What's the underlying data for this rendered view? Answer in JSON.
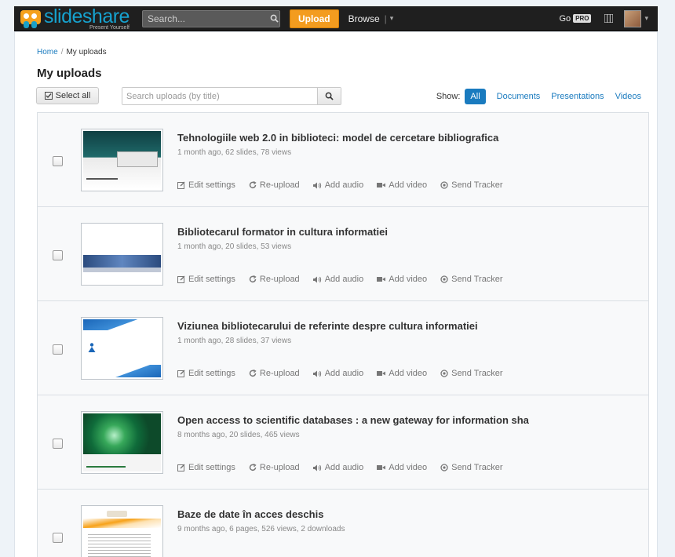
{
  "navbar": {
    "logo_main": "slideshare",
    "logo_tagline": "Present Yourself",
    "search_placeholder": "Search...",
    "upload_label": "Upload",
    "browse_label": "Browse",
    "go_label": "Go",
    "pro_badge": "PRO"
  },
  "breadcrumb": {
    "home": "Home",
    "separator": "/",
    "current": "My uploads"
  },
  "page_title": "My uploads",
  "toolbar": {
    "select_all_label": "Select all",
    "search_placeholder": "Search uploads (by title)",
    "show_label": "Show:",
    "filters": [
      {
        "label": "All",
        "active": true
      },
      {
        "label": "Documents",
        "active": false
      },
      {
        "label": "Presentations",
        "active": false
      },
      {
        "label": "Videos",
        "active": false
      }
    ]
  },
  "action_labels": {
    "edit": "Edit settings",
    "reupload": "Re-upload",
    "audio": "Add audio",
    "video": "Add video",
    "tracker": "Send Tracker"
  },
  "uploads": [
    {
      "title": "Tehnologiile web 2.0 in biblioteci: model de cercetare bibliografica",
      "meta": "1 month ago, 62 slides, 78 views"
    },
    {
      "title": "Bibliotecarul formator in cultura informatiei",
      "meta": "1 month ago, 20 slides, 53 views"
    },
    {
      "title": "Viziunea bibliotecarului de referinte despre cultura informatiei",
      "meta": "1 month ago, 28 slides, 37 views"
    },
    {
      "title": "Open access to scientific databases : a new gateway for information sha",
      "meta": "8 months ago, 20 slides, 465 views"
    },
    {
      "title": "Baze de date în acces deschis",
      "meta": "9 months ago, 6 pages, 526 views, 2 downloads"
    }
  ],
  "colors": {
    "brand_blue": "#1a7bbf",
    "upload_orange": "#f39c1f",
    "navbar_bg": "#1f1f1f"
  },
  "icons": {
    "search": "magnifier-icon",
    "edit": "pencil-icon",
    "reupload": "refresh-icon",
    "audio": "speaker-icon",
    "video": "camera-icon",
    "tracker": "target-icon"
  }
}
